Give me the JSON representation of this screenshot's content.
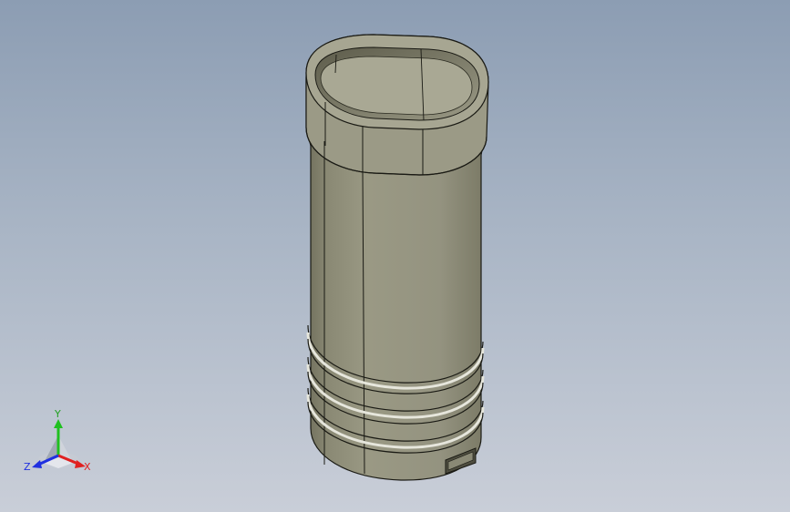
{
  "viewport": {
    "background_top": "#8c9db3",
    "background_bottom": "#c9ced8"
  },
  "model": {
    "name_icon": "oval-tube-part",
    "body_color": "#8f8e79",
    "shade_color": "#6e6d5a",
    "edge_color": "#1a1a14",
    "highlight_color": "#e8e8e0"
  },
  "triad": {
    "x_label": "X",
    "y_label": "Y",
    "z_label": "Z",
    "x_color": "#e02020",
    "y_color": "#20c020",
    "z_color": "#2030e0"
  }
}
